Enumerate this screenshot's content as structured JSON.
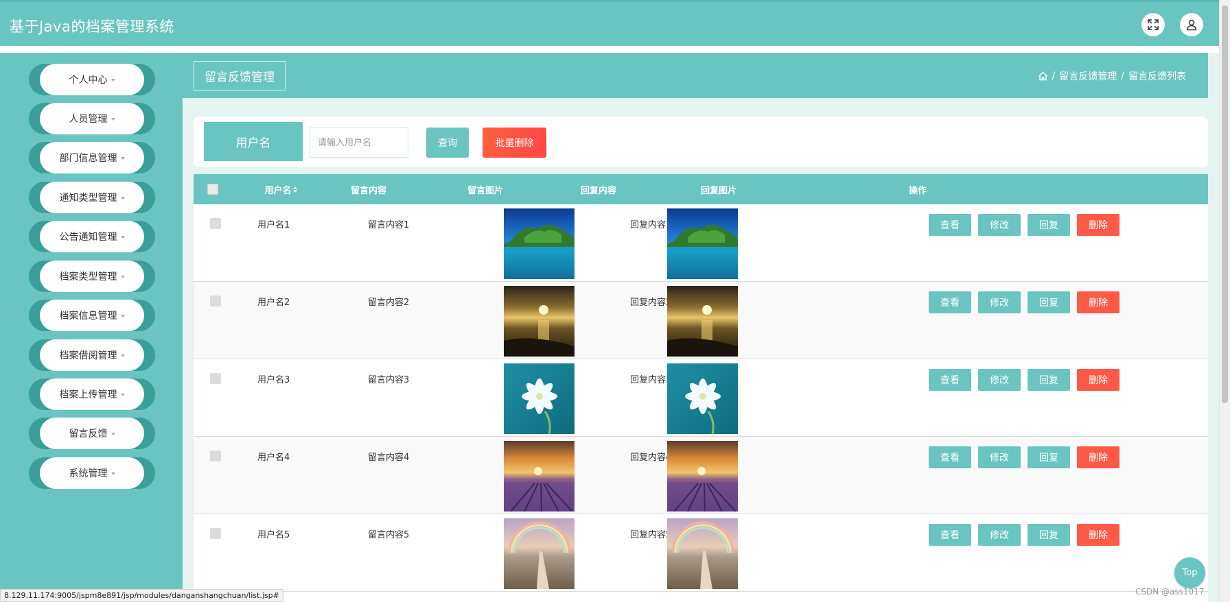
{
  "app": {
    "title": "基于Java的档案管理系统"
  },
  "header_icons": [
    "fullscreen-icon",
    "user-icon"
  ],
  "sidebar": {
    "items": [
      {
        "label": "个人中心"
      },
      {
        "label": "人员管理"
      },
      {
        "label": "部门信息管理"
      },
      {
        "label": "通知类型管理"
      },
      {
        "label": "公告通知管理"
      },
      {
        "label": "档案类型管理"
      },
      {
        "label": "档案信息管理"
      },
      {
        "label": "档案借阅管理"
      },
      {
        "label": "档案上传管理"
      },
      {
        "label": "留言反馈"
      },
      {
        "label": "系统管理"
      }
    ]
  },
  "page": {
    "title": "留言反馈管理",
    "breadcrumb": [
      "留言反馈管理",
      "留言反馈列表"
    ],
    "breadcrumb_sep": "/"
  },
  "search": {
    "label": "用户名",
    "placeholder": "请输入用户名",
    "query_button": "查询",
    "batch_delete_button": "批量删除"
  },
  "table": {
    "columns": [
      "用户名",
      "留言内容",
      "留言图片",
      "回复内容",
      "回复图片",
      "操作"
    ],
    "actions": [
      "查看",
      "修改",
      "回复",
      "删除"
    ],
    "rows": [
      {
        "username": "用户名1",
        "content": "留言内容1",
        "reply": "回复内容1",
        "image": "island-sea"
      },
      {
        "username": "用户名2",
        "content": "留言内容2",
        "reply": "回复内容2",
        "image": "sunset-beach"
      },
      {
        "username": "用户名3",
        "content": "留言内容3",
        "reply": "回复内容3",
        "image": "white-flower"
      },
      {
        "username": "用户名4",
        "content": "留言内容4",
        "reply": "回复内容4",
        "image": "lavender-field"
      },
      {
        "username": "用户名5",
        "content": "留言内容5",
        "reply": "回复内容5",
        "image": "rainbow-path"
      }
    ]
  },
  "status_bar": {
    "url": "8.129.11.174:9005/jspm8e891/jsp/modules/danganshangchuan/list.jsp#"
  },
  "back_to_top": "Top",
  "watermark": "CSDN @ass1017",
  "colors": {
    "primary": "#6ac5c0",
    "sidebar_dark": "#3a9e99",
    "danger": "#ff5a47",
    "content_bg": "#e5f3f1"
  }
}
